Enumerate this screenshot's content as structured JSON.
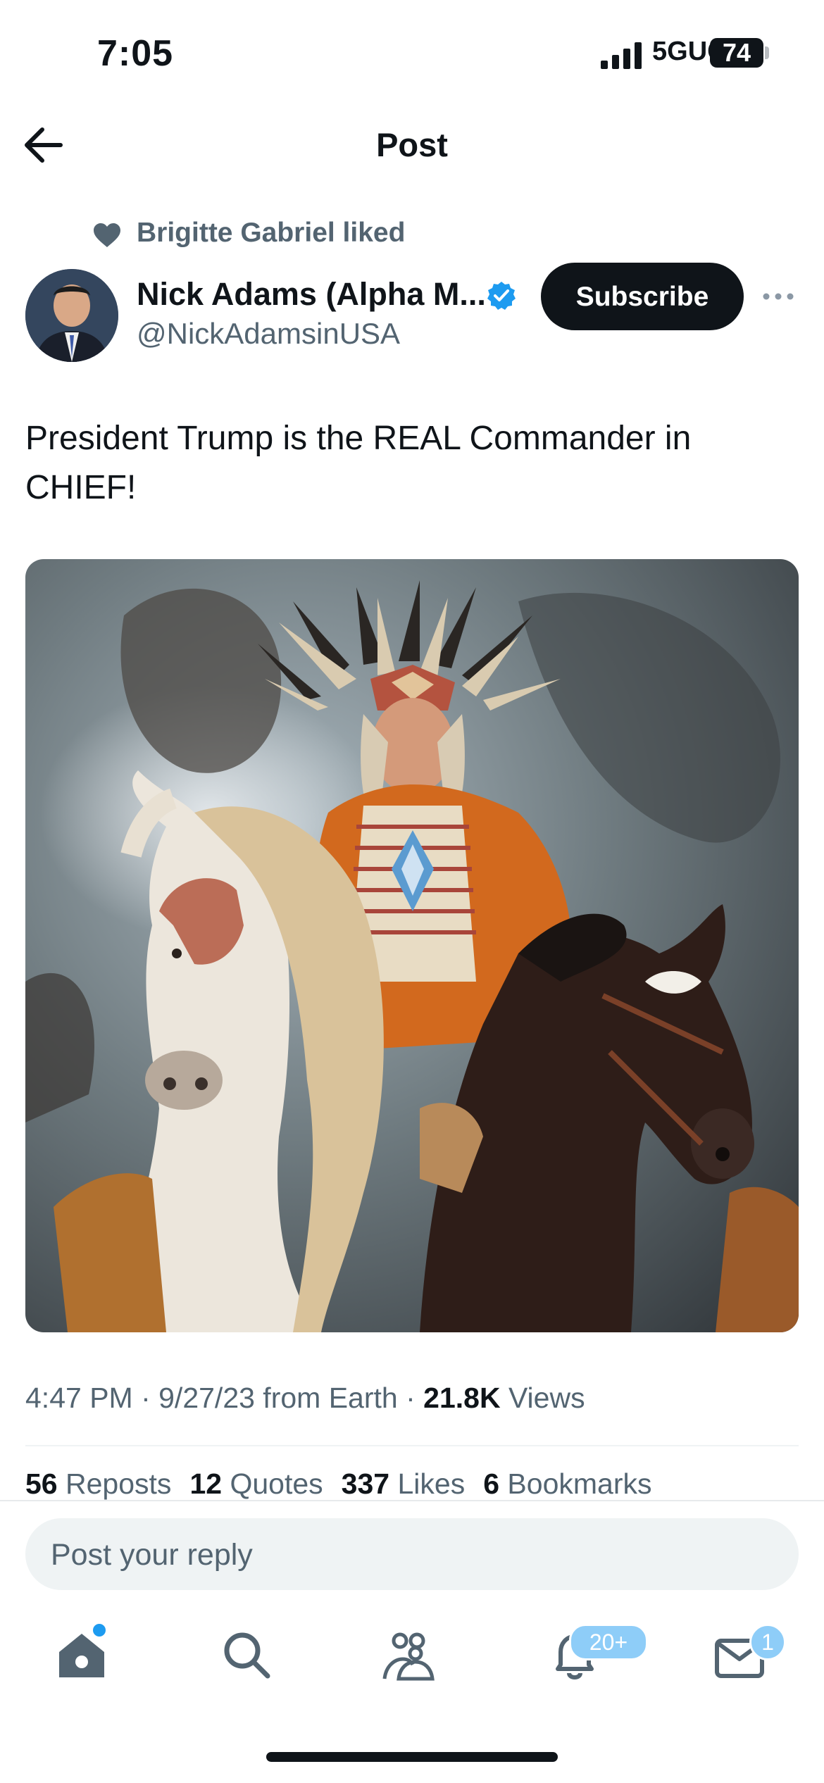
{
  "status_bar": {
    "time": "7:05",
    "network": "5GUC",
    "battery": "74"
  },
  "header": {
    "title": "Post"
  },
  "social_context": {
    "text": "Brigitte Gabriel liked"
  },
  "author": {
    "display_name": "Nick Adams (Alpha M...",
    "handle": "@NickAdamsinUSA",
    "verified": true,
    "subscribe_label": "Subscribe"
  },
  "post": {
    "text": "President Trump is the REAL Commander in CHIEF!",
    "meta_prefix": "4:47 PM · 9/27/23 from Earth · ",
    "views_count": "21.8K",
    "views_label": " Views"
  },
  "stats": {
    "reposts_count": "56",
    "reposts_label": "Reposts",
    "quotes_count": "12",
    "quotes_label": "Quotes",
    "likes_count": "337",
    "likes_label": "Likes",
    "bookmarks_count": "6",
    "bookmarks_label": "Bookmarks"
  },
  "reply": {
    "placeholder": "Post your reply"
  },
  "tab_bar": {
    "notifications_badge": "20+",
    "messages_badge": "1",
    "icons": [
      "home-icon",
      "search-icon",
      "communities-icon",
      "notifications-icon",
      "messages-icon"
    ]
  },
  "colors": {
    "accent": "#1d9bf0",
    "text": "#0f1419",
    "secondary": "#536471",
    "badge": "#8ecdf8"
  }
}
